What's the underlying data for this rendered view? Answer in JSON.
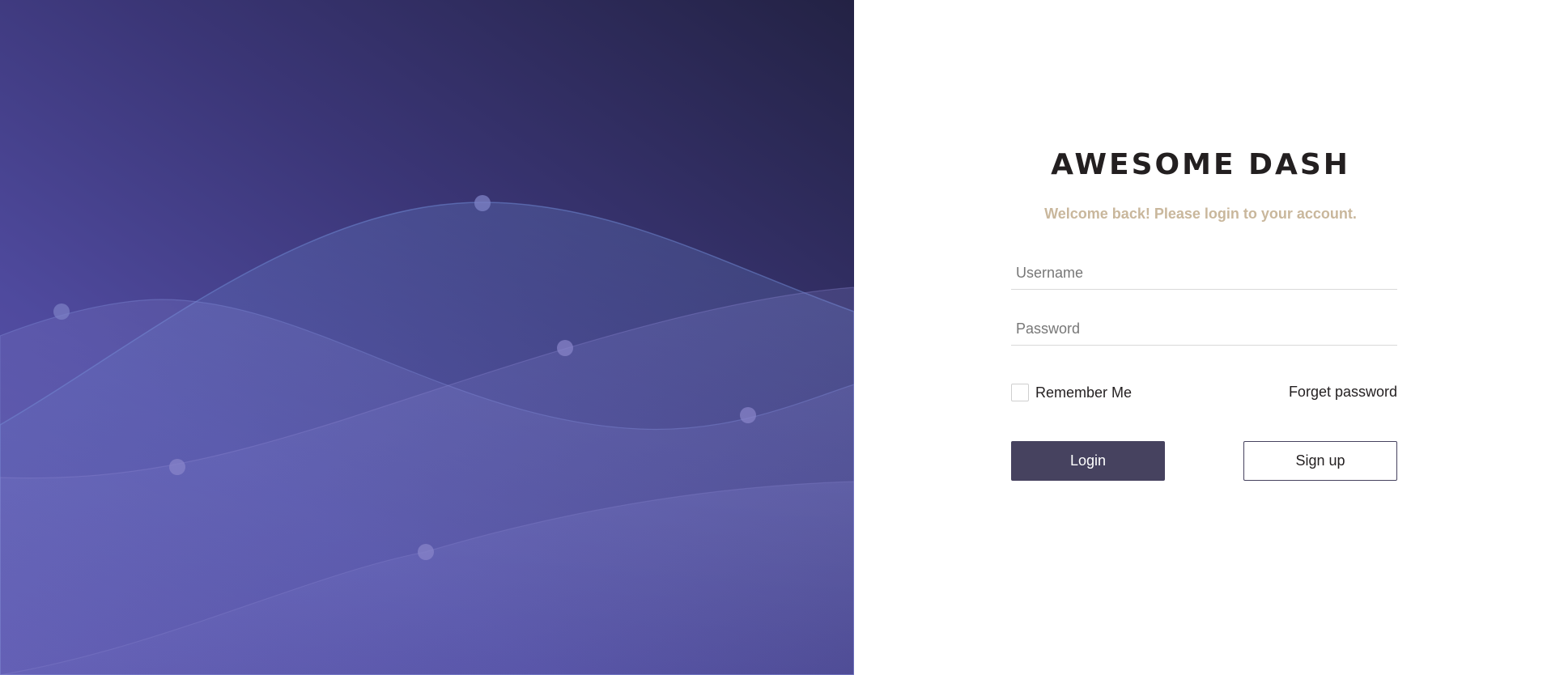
{
  "brand": {
    "title": "AWESOME DASH",
    "subtitle": "Welcome back! Please login to your account."
  },
  "form": {
    "username_placeholder": "Username",
    "username_value": "",
    "password_placeholder": "Password",
    "password_value": "",
    "remember_label": "Remember Me",
    "remember_checked": false,
    "forgot_label": "Forget password",
    "login_label": "Login",
    "signup_label": "Sign up"
  },
  "colors": {
    "hero_gradient_light": "#5f59b0",
    "hero_gradient_dark": "#232244",
    "title": "#231f20",
    "subtitle": "#c9b79c",
    "login_button": "#46425f",
    "signup_border": "#46425f"
  },
  "icons": {
    "checkbox": "checkbox-unchecked-icon"
  }
}
